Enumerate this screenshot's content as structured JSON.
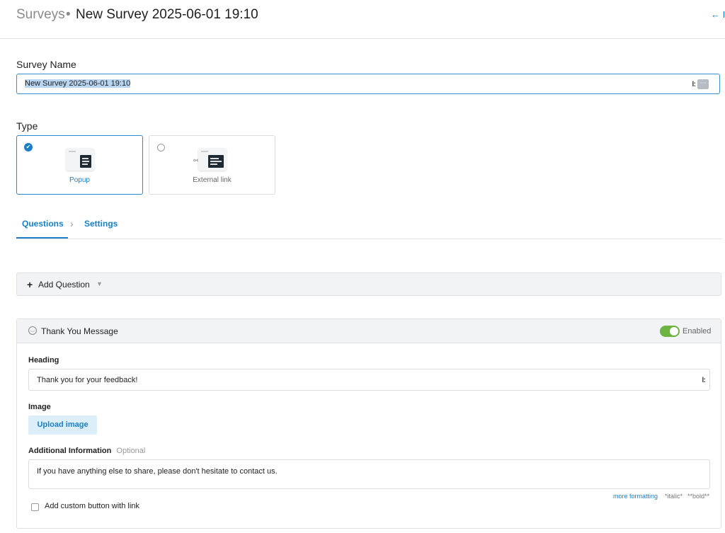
{
  "header": {
    "breadcrumb_root": "Surveys",
    "separator": "•",
    "title": "New Survey 2025-06-01 19:10",
    "back_icon": "← I"
  },
  "survey_name": {
    "label": "Survey Name",
    "value": "New Survey 2025-06-01 19:10",
    "more_icon": "⋯"
  },
  "type": {
    "label": "Type",
    "options": [
      {
        "label": "Popup",
        "selected": true
      },
      {
        "label": "External link",
        "selected": false
      }
    ]
  },
  "tabs": [
    {
      "label": "Questions",
      "active": true
    },
    {
      "label": "Settings",
      "active": false
    }
  ],
  "add_question": {
    "label": "Add Question"
  },
  "thank_you": {
    "title": "Thank You Message",
    "toggle_label": "Enabled",
    "heading_label": "Heading",
    "heading_value": "Thank you for your feedback!",
    "image_label": "Image",
    "upload_button": "Upload image",
    "additional_label": "Additional Information",
    "optional_label": "Optional",
    "additional_value": "If you have anything else to share, please don't hesitate to contact us.",
    "formatting": {
      "more": "more formatting",
      "italic": "*italic*",
      "bold": "**bold**"
    },
    "custom_button_label": "Add custom button with link"
  },
  "colors": {
    "accent": "#1a7fc7",
    "toggle_on": "#6db33f",
    "selection": "#b8d5f1"
  }
}
